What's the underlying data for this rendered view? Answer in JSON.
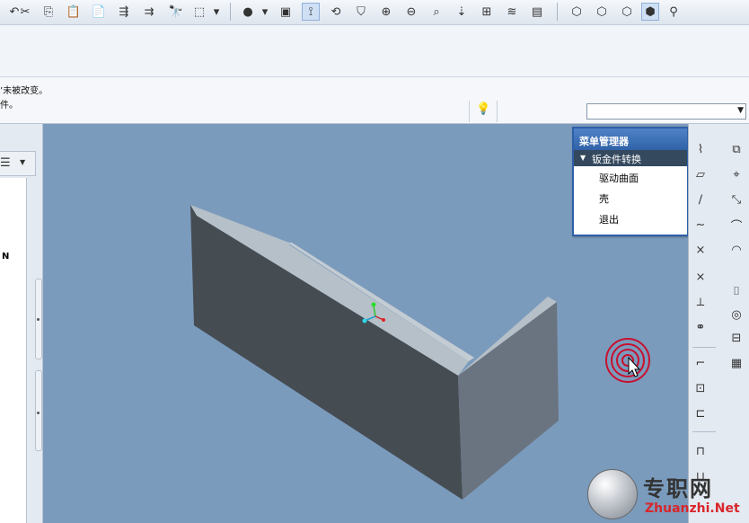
{
  "toolbar": {
    "icons": [
      "cut-icon",
      "copy-icon",
      "paste-icon",
      "paste-special-icon",
      "regenerate-icon",
      "regenerate-manager-icon",
      "find-icon",
      "select-box-icon",
      "shading-icon",
      "redraw-icon",
      "spin-center-icon",
      "orient-mode-icon",
      "saved-views-icon",
      "zoom-in-icon",
      "zoom-out-icon",
      "refit-icon",
      "reorient-icon",
      "view-manager-icon",
      "layers-icon",
      "display-style-icon",
      "wireframe-icon",
      "hidden-line-icon",
      "no-hidden-icon",
      "shaded-icon",
      "model-tree-icon"
    ]
  },
  "message_area": {
    "line1": "’未被改变。",
    "line2": "件。",
    "filter_value": ""
  },
  "left_panel": {
    "tree_label": "N"
  },
  "menu_manager": {
    "title": "菜单管理器",
    "submenu": "钣金件转换",
    "items": [
      "驱动曲面",
      "壳",
      "退出"
    ]
  },
  "watermark": {
    "text": "专职网",
    "url": "Zhuanzhi.Net"
  },
  "colors": {
    "viewport_bg": "#7b9bbd",
    "menu_title": "#2f62a8",
    "menu_submenu": "#34495e",
    "model_front": "#454c52",
    "model_top": "#b6c0c8",
    "model_side": "#6a7480",
    "target_red": "#c8102e",
    "watermark_url": "#d8262b"
  }
}
